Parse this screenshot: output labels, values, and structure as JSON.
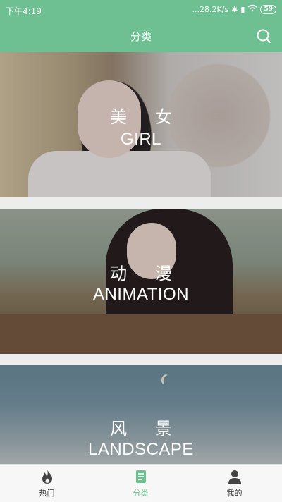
{
  "status_bar": {
    "time": "下午4:19",
    "network_speed": "...28.2K/s",
    "battery": "59"
  },
  "header": {
    "title": "分类"
  },
  "categories": [
    {
      "name_cn": "美 女",
      "name_en": "GIRL"
    },
    {
      "name_cn": "动 漫",
      "name_en": "ANIMATION"
    },
    {
      "name_cn": "风 景",
      "name_en": "LANDSCAPE"
    }
  ],
  "tabbar": {
    "tabs": [
      {
        "label": "热门",
        "icon": "flame-icon"
      },
      {
        "label": "分类",
        "icon": "category-list-icon"
      },
      {
        "label": "我的",
        "icon": "user-icon"
      }
    ],
    "active_index": 1
  },
  "colors": {
    "accent": "#6ec092",
    "tab_inactive": "#333333"
  }
}
